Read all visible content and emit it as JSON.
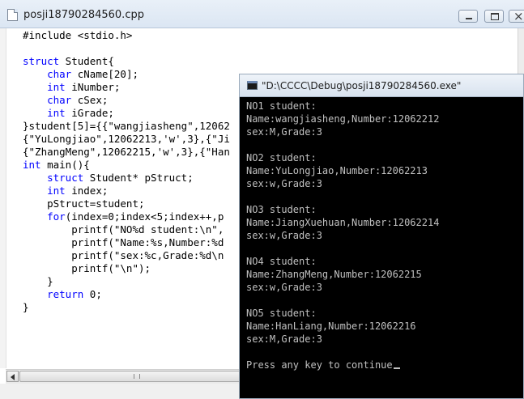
{
  "editor": {
    "title": "posji18790284560.cpp",
    "lines": [
      [
        {
          "t": "#include <stdio.h>",
          "k": false
        }
      ],
      [
        {
          "t": "",
          "k": false
        }
      ],
      [
        {
          "t": "struct",
          "k": true
        },
        {
          "t": " Student{",
          "k": false
        }
      ],
      [
        {
          "t": "    ",
          "k": false
        },
        {
          "t": "char",
          "k": true
        },
        {
          "t": " cName[20];",
          "k": false
        }
      ],
      [
        {
          "t": "    ",
          "k": false
        },
        {
          "t": "int",
          "k": true
        },
        {
          "t": " iNumber;",
          "k": false
        }
      ],
      [
        {
          "t": "    ",
          "k": false
        },
        {
          "t": "char",
          "k": true
        },
        {
          "t": " cSex;",
          "k": false
        }
      ],
      [
        {
          "t": "    ",
          "k": false
        },
        {
          "t": "int",
          "k": true
        },
        {
          "t": " iGrade;",
          "k": false
        }
      ],
      [
        {
          "t": "}student[5]={{\"wangjiasheng\",12062",
          "k": false
        }
      ],
      [
        {
          "t": "{\"YuLongjiao\",12062213,'w',3},{\"Ji",
          "k": false
        }
      ],
      [
        {
          "t": "{\"ZhangMeng\",12062215,'w',3},{\"Han",
          "k": false
        }
      ],
      [
        {
          "t": "int",
          "k": true
        },
        {
          "t": " main(){",
          "k": false
        }
      ],
      [
        {
          "t": "    ",
          "k": false
        },
        {
          "t": "struct",
          "k": true
        },
        {
          "t": " Student* pStruct;",
          "k": false
        }
      ],
      [
        {
          "t": "    ",
          "k": false
        },
        {
          "t": "int",
          "k": true
        },
        {
          "t": " index;",
          "k": false
        }
      ],
      [
        {
          "t": "    pStruct=student;",
          "k": false
        }
      ],
      [
        {
          "t": "    ",
          "k": false
        },
        {
          "t": "for",
          "k": true
        },
        {
          "t": "(index=0;index<5;index++,p",
          "k": false
        }
      ],
      [
        {
          "t": "        printf(\"NO%d student:\\n\",",
          "k": false
        }
      ],
      [
        {
          "t": "        printf(\"Name:%s,Number:%d",
          "k": false
        }
      ],
      [
        {
          "t": "        printf(\"sex:%c,Grade:%d\\n",
          "k": false
        }
      ],
      [
        {
          "t": "        printf(\"\\n\");",
          "k": false
        }
      ],
      [
        {
          "t": "    }",
          "k": false
        }
      ],
      [
        {
          "t": "    ",
          "k": false
        },
        {
          "t": "return",
          "k": true
        },
        {
          "t": " 0;",
          "k": false
        }
      ],
      [
        {
          "t": "}",
          "k": false
        }
      ]
    ]
  },
  "console": {
    "title": "\"D:\\CCCC\\Debug\\posji18790284560.exe\"",
    "lines": [
      "NO1 student:",
      "Name:wangjiasheng,Number:12062212",
      "sex:M,Grade:3",
      "",
      "NO2 student:",
      "Name:YuLongjiao,Number:12062213",
      "sex:w,Grade:3",
      "",
      "NO3 student:",
      "Name:JiangXuehuan,Number:12062214",
      "sex:w,Grade:3",
      "",
      "NO4 student:",
      "Name:ZhangMeng,Number:12062215",
      "sex:w,Grade:3",
      "",
      "NO5 student:",
      "Name:HanLiang,Number:12062216",
      "sex:M,Grade:3",
      "",
      "Press any key to continue"
    ]
  },
  "icons": {
    "editor_doc": "document-icon",
    "console_app": "console-app-icon",
    "minimize": "minimize-icon",
    "maximize": "maximize-icon",
    "close": "close-icon",
    "scroll_left": "arrow-left-icon"
  },
  "colors": {
    "keyword": "#0000ff",
    "console_bg": "#000000",
    "console_text": "#c0c0c0"
  }
}
